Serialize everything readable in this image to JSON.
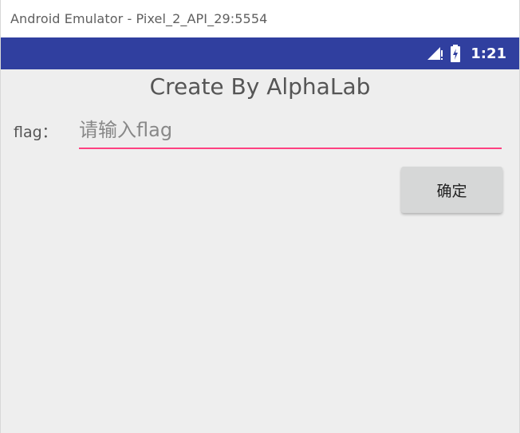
{
  "window": {
    "title": "Android Emulator - Pixel_2_API_29:5554"
  },
  "status_bar": {
    "time": "1:21",
    "icons": [
      "signal-icon",
      "battery-icon"
    ],
    "color": "#303f9f"
  },
  "app": {
    "title": "Create By AlphaLab",
    "flag_label": "flag：",
    "flag_input": {
      "value": "",
      "placeholder": "请输入flag"
    },
    "confirm_label": "确定",
    "accent_color": "#ff4081",
    "background_color": "#eeeeee"
  }
}
